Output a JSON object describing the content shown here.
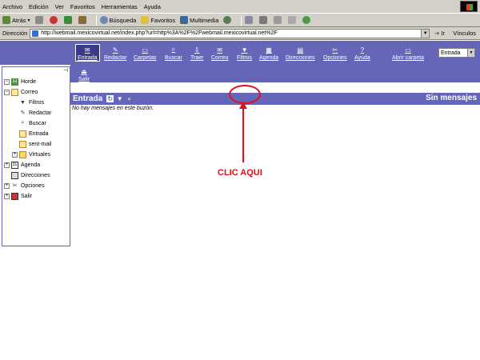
{
  "browser": {
    "menu": [
      "Archivo",
      "Edición",
      "Ver",
      "Favoritos",
      "Herramientas",
      "Ayuda"
    ],
    "toolbar": {
      "back": "Atrás",
      "search": "Búsqueda",
      "favorites": "Favoritos",
      "multimedia": "Multimedia"
    },
    "address": {
      "label": "Dirección",
      "url": "http://webmail.mexicovirtual.net/index.php?url=http%3A%2F%2Fwebmail.mexicovirtual.net%2F",
      "go": "Ir",
      "links": "Vínculos"
    }
  },
  "nav": {
    "items": [
      {
        "label": "Entrada",
        "icon": "inbox-icon"
      },
      {
        "label": "Redactar",
        "icon": "compose-icon"
      },
      {
        "label": "Carpetas",
        "icon": "folders-icon"
      },
      {
        "label": "Buscar",
        "icon": "search-icon"
      },
      {
        "label": "Traer",
        "icon": "fetch-icon"
      },
      {
        "label": "Correo",
        "icon": "mail-icon"
      },
      {
        "label": "Filtros",
        "icon": "filter-icon"
      },
      {
        "label": "Agenda",
        "icon": "calendar-icon"
      },
      {
        "label": "Direcciones",
        "icon": "addressbook-icon"
      },
      {
        "label": "Opciones",
        "icon": "options-icon"
      },
      {
        "label": "Ayuda",
        "icon": "help-icon"
      },
      {
        "label": "Abrir carpeta",
        "icon": "open-folder-icon"
      }
    ],
    "salir": "Salir",
    "folder_select": "Entrada"
  },
  "sidebar": {
    "tree": [
      {
        "label": "Horde",
        "icon": "horde-icon"
      },
      {
        "label": "Correo",
        "icon": "mail-icon"
      },
      {
        "label": "Filtros",
        "icon": "filter-icon"
      },
      {
        "label": "Redactar",
        "icon": "compose-icon"
      },
      {
        "label": "Buscar",
        "icon": "search-icon"
      },
      {
        "label": "Entrada",
        "icon": "inbox-icon"
      },
      {
        "label": "sent-mail",
        "icon": "sent-icon"
      },
      {
        "label": "Virtuales",
        "icon": "folder-icon"
      },
      {
        "label": "Agenda",
        "icon": "calendar-icon"
      },
      {
        "label": "Direcciones",
        "icon": "addressbook-icon"
      },
      {
        "label": "Opciones",
        "icon": "options-icon"
      },
      {
        "label": "Salir",
        "icon": "logout-icon"
      }
    ]
  },
  "mailbox": {
    "title": "Entrada",
    "status": "Sin mensajes",
    "empty": "No hay mensajes en este buzón."
  },
  "annotation": {
    "text": "CLIC AQUI"
  },
  "colors": {
    "nav_bg": "#6666b8",
    "annotation": "#e0101a",
    "chrome": "#d4d0c8"
  }
}
